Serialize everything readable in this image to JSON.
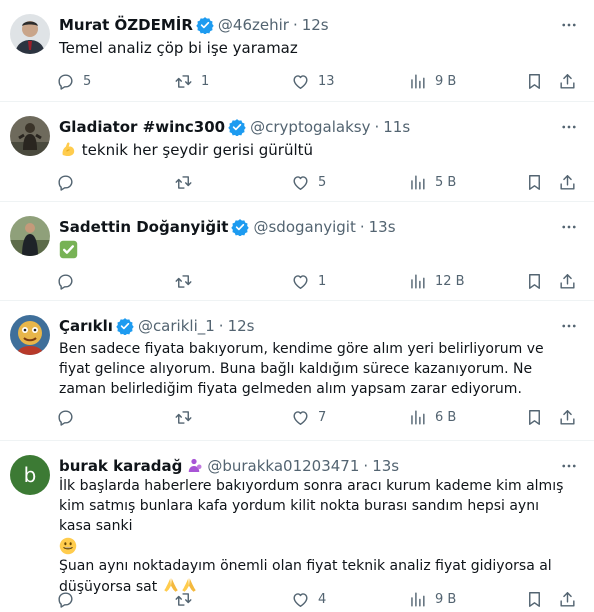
{
  "colors": {
    "verified": "#1d9bf0",
    "text": "#0f1419",
    "muted": "#536471",
    "divider": "#eff3f4"
  },
  "tweets": [
    {
      "name": "Murat ÖZDEMİR",
      "handle": "@46zehir",
      "time": "12s",
      "text": "Temel analiz çöp bi işe yaramaz",
      "replies": "5",
      "retweets": "1",
      "likes": "13",
      "views": "9 B"
    },
    {
      "name": "Gladiator #winc300",
      "handle": "@cryptogalaksy",
      "time": "11s",
      "text": "teknik her şeydir gerisi gürültü",
      "replies": "",
      "retweets": "",
      "likes": "5",
      "views": "5 B"
    },
    {
      "name": "Sadettin Doğanyiğit",
      "handle": "@sdoganyigit",
      "time": "13s",
      "text": "",
      "replies": "",
      "retweets": "",
      "likes": "1",
      "views": "12 B"
    },
    {
      "name": "Çarıklı",
      "handle": "@carikli_1",
      "time": "12s",
      "text": "Ben sadece fiyata bakıyorum, kendime göre alım yeri belirliyorum ve fiyat gelince alıyorum. Buna bağlı kaldığım sürece kazanıyorum. Ne zaman belirlediğim fiyata gelmeden alım yapsam zarar ediyorum.",
      "replies": "",
      "retweets": "",
      "likes": "7",
      "views": "6 B"
    },
    {
      "name": "burak karadağ",
      "handle": "@burakka01203471",
      "time": "13s",
      "avatar_letter": "b",
      "text": "İlk başlarda haberlere bakıyordum sonra aracı kurum kademe kim almış kim satmış bunlara kafa yordum kilit nokta burası sandım hepsi aynı kasa sanki",
      "text2": "Şuan aynı noktadayım önemli olan fiyat teknik analiz fiyat gidiyorsa al düşüyorsa sat",
      "replies": "",
      "retweets": "",
      "likes": "4",
      "views": "9 B"
    }
  ]
}
